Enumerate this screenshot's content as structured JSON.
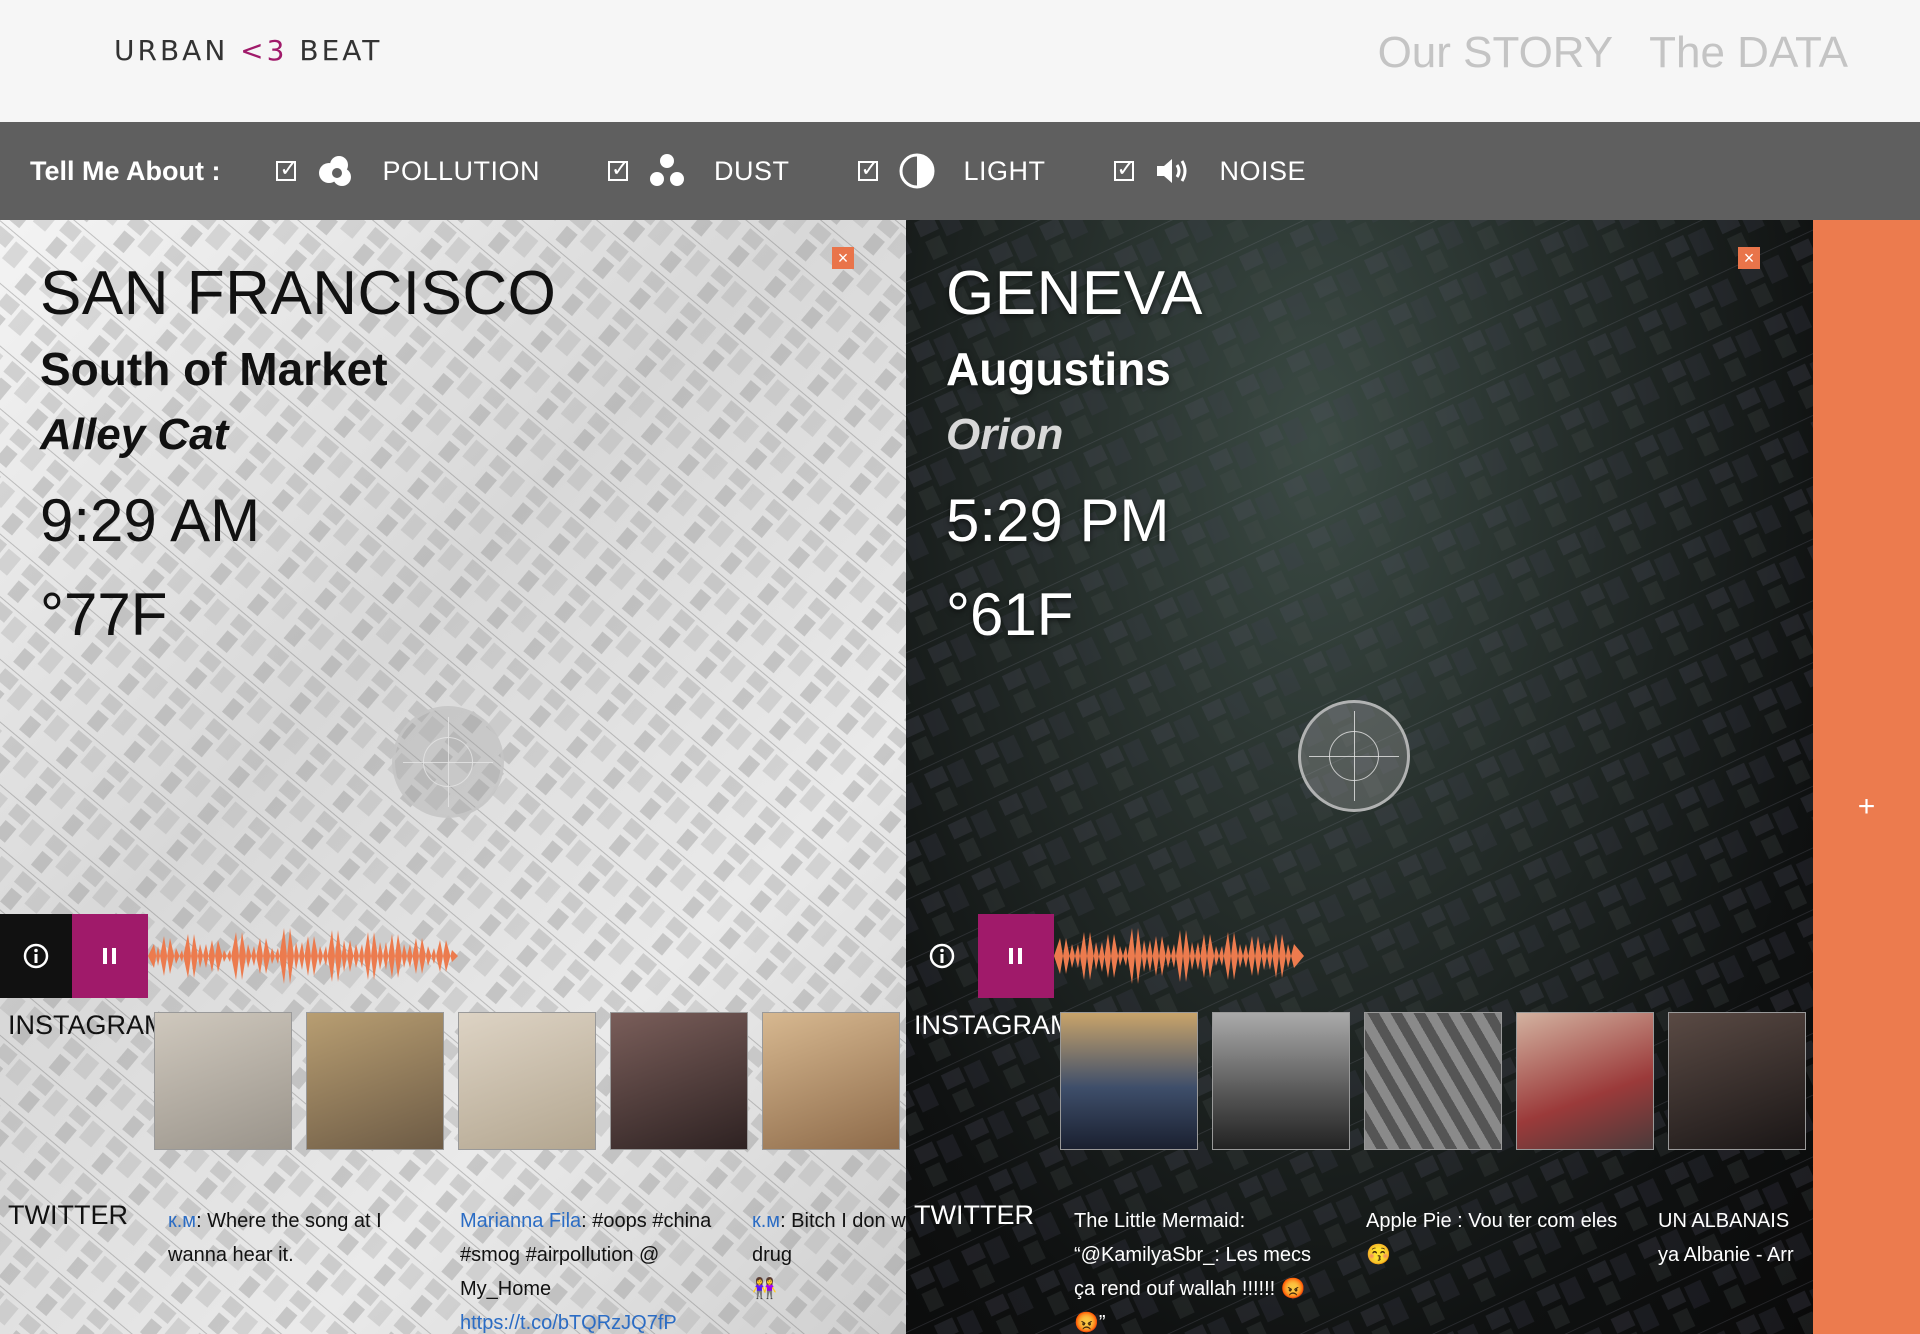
{
  "header": {
    "logo_part1": "URBAN",
    "logo_heart": "<3",
    "logo_part2": "BEAT",
    "nav": [
      "Our STORY",
      "The DATA"
    ]
  },
  "toolbar": {
    "label": "Tell Me About :",
    "options": [
      {
        "label": "POLLUTION",
        "icon": "pollution-cloud-icon",
        "checked": true
      },
      {
        "label": "DUST",
        "icon": "dust-dots-icon",
        "checked": true
      },
      {
        "label": "LIGHT",
        "icon": "light-contrast-icon",
        "checked": true
      },
      {
        "label": "NOISE",
        "icon": "speaker-icon",
        "checked": true
      }
    ]
  },
  "panels": [
    {
      "city": "SAN FRANCISCO",
      "neighborhood": "South of Market",
      "sensor": "Alley Cat",
      "time": "9:29 AM",
      "temperature": "°77F",
      "instagram_label": "INSTAGRAM",
      "twitter_label": "TWITTER",
      "thumb_colors": [
        "#b9b2a8",
        "#8c7d66",
        "#c9bfb1",
        "#5c4a48",
        "#c1a27e"
      ],
      "tweets": [
        {
          "user": "к.м",
          "text": ": Where the song at I wanna hear it.",
          "extra": ""
        },
        {
          "user": "Marianna Fila",
          "text": ": #oops #china #smog #airpollution @ My_Home",
          "extra": "https://t.co/bTQRzJQ7fP"
        },
        {
          "user": "к.м",
          "text": ": Bitch I don weed that drug",
          "extra": "👭"
        }
      ]
    },
    {
      "city": "GENEVA",
      "neighborhood": "Augustins",
      "sensor": "Orion",
      "time": "5:29 PM",
      "temperature": "°61F",
      "instagram_label": "INSTAGRAM",
      "twitter_label": "TWITTER",
      "thumb_colors": [
        "#4a5566",
        "#5f5f5f",
        "#7a7a7a",
        "#a56a5c",
        "#3a3332"
      ],
      "tweets": [
        {
          "user": "The Little Mermaid",
          "text": ": “@KamilyaSbr_: Les mecs ça rend ouf wallah !!!!!! 😡😡”",
          "extra": ""
        },
        {
          "user": "Apple Pie",
          "text": " : Vou ter com eles 😚",
          "extra": ""
        },
        {
          "user": "UN ALBANAIS",
          "text": " ya Albanie - Arr",
          "extra": ""
        }
      ]
    }
  ],
  "add_column": {
    "label": "+"
  },
  "colors": {
    "accent": "#a01a6a",
    "orange": "#ec7b4e",
    "toolbar": "#5f5f5f"
  }
}
